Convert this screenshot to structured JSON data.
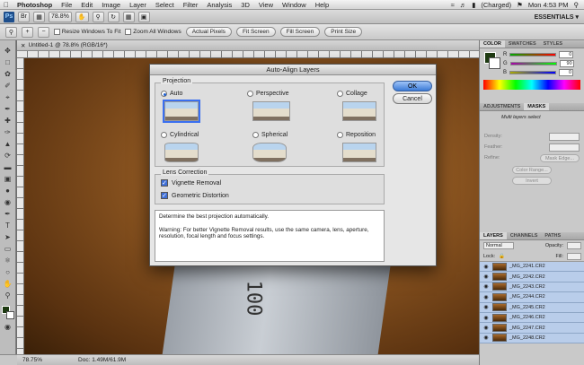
{
  "menubar": {
    "items": [
      "Photoshop",
      "File",
      "Edit",
      "Image",
      "Layer",
      "Select",
      "Filter",
      "Analysis",
      "3D",
      "View",
      "Window",
      "Help"
    ],
    "battery": "(Charged)",
    "clock": "Mon 4:53 PM"
  },
  "appbar": {
    "ps_label": "Ps",
    "zoom": "78.8%",
    "workspace": "ESSENTIALS ▾"
  },
  "options": {
    "resize_windows": "Resize Windows To Fit",
    "zoom_all": "Zoom All Windows",
    "actual_pixels": "Actual Pixels",
    "fit_screen": "Fit Screen",
    "fill_screen": "Fill Screen",
    "print_size": "Print Size"
  },
  "document": {
    "tab_title": "Untitled-1 @ 78.8% (RGB/16*)",
    "canvas_text": "100",
    "status_zoom": "78.75%",
    "status_doc": "Doc: 1.49M/61.9M"
  },
  "color_panel": {
    "tabs": [
      "COLOR",
      "SWATCHES",
      "STYLES"
    ],
    "channels": [
      {
        "label": "R",
        "value": "0"
      },
      {
        "label": "G",
        "value": "90"
      },
      {
        "label": "B",
        "value": "0"
      }
    ]
  },
  "adjust_panel": {
    "tabs": [
      "ADJUSTMENTS",
      "MASKS"
    ],
    "header": "Multi layers select",
    "density_label": "Density:",
    "feather_label": "Feather:",
    "refine_label": "Refine:",
    "mask_edge": "Mask Edge...",
    "color_range": "Color Range...",
    "invert": "Invert"
  },
  "layers_panel": {
    "tabs": [
      "LAYERS",
      "CHANNELS",
      "PATHS"
    ],
    "blend_mode": "Normal",
    "opacity_label": "Opacity:",
    "lock_label": "Lock:",
    "fill_label": "Fill:",
    "layers": [
      "_MG_2241.CR2",
      "_MG_2242.CR2",
      "_MG_2243.CR2",
      "_MG_2244.CR2",
      "_MG_2245.CR2",
      "_MG_2246.CR2",
      "_MG_2247.CR2",
      "_MG_2248.CR2"
    ]
  },
  "dialog": {
    "title": "Auto-Align Layers",
    "projection_label": "Projection",
    "options": {
      "auto": "Auto",
      "perspective": "Perspective",
      "collage": "Collage",
      "cylindrical": "Cylindrical",
      "spherical": "Spherical",
      "reposition": "Reposition"
    },
    "selected": "Auto",
    "lens_label": "Lens Correction",
    "vignette": "Vignette Removal",
    "geometric": "Geometric Distortion",
    "ok": "OK",
    "cancel": "Cancel",
    "description": "Determine the best projection automatically.",
    "warning": "Warning: For better Vignette Removal results, use the same camera, lens, aperture, resolution, focal length and focus settings."
  }
}
